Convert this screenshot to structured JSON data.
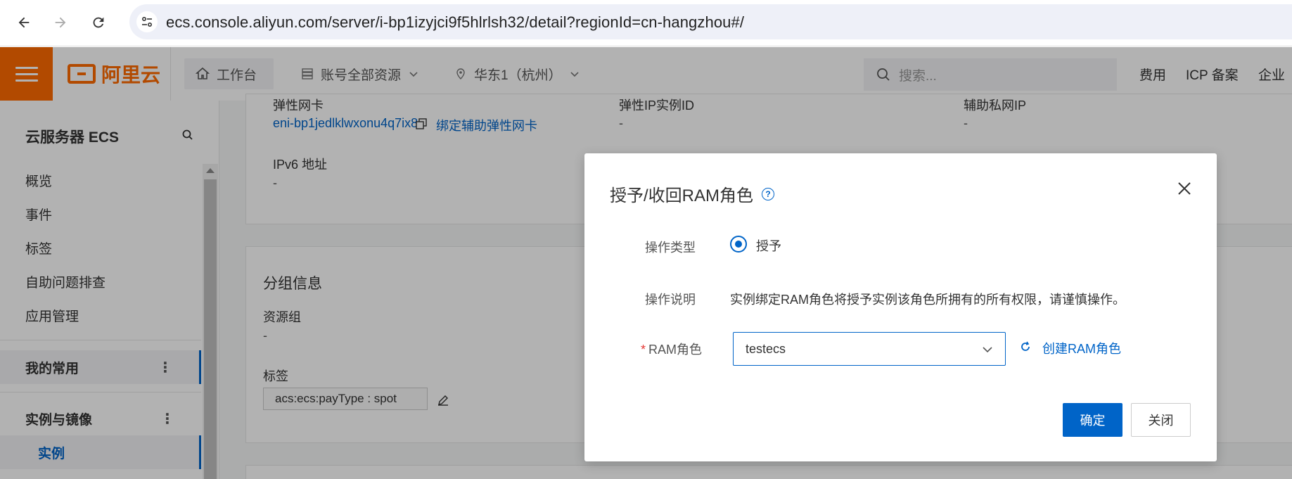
{
  "browser": {
    "url": "ecs.console.aliyun.com/server/i-bp1izyjci9f5hlrlsh32/detail?regionId=cn-hangzhou#/"
  },
  "header": {
    "brand": "阿里云",
    "workbench": "工作台",
    "resources": "账号全部资源",
    "region": "华东1（杭州）",
    "search_placeholder": "搜索...",
    "links": [
      "费用",
      "ICP 备案",
      "企业"
    ]
  },
  "sidebar": {
    "title": "云服务器 ECS",
    "items": [
      "概览",
      "事件",
      "标签",
      "自助问题排查",
      "应用管理"
    ],
    "sections": [
      {
        "label": "我的常用",
        "active": true
      },
      {
        "label": "实例与镜像",
        "active": false
      }
    ],
    "active_sub": "实例"
  },
  "main": {
    "network": {
      "eni_label": "弹性网卡",
      "eni_value": "eni-bp1jedlklwxonu4q7ix8",
      "bind_link": "绑定辅助弹性网卡",
      "eip_label": "弹性IP实例ID",
      "eip_value": "-",
      "private_ip_label": "辅助私网IP",
      "private_ip_value": "-",
      "ipv6_label": "IPv6 地址",
      "ipv6_value": "-"
    },
    "group": {
      "title": "分组信息",
      "resource_group_label": "资源组",
      "resource_group_value": "-",
      "tags_label": "标签",
      "tag_value": "acs:ecs:payType : spot"
    }
  },
  "dialog": {
    "title": "授予/收回RAM角色",
    "op_type_label": "操作类型",
    "op_type_value": "授予",
    "op_desc_label": "操作说明",
    "op_desc_value": "实例绑定RAM角色将授予实例该角色所拥有的所有权限，请谨慎操作。",
    "ram_role_required": "*",
    "ram_role_label": "RAM角色",
    "ram_role_value": "testecs",
    "create_link": "创建RAM角色",
    "confirm": "确定",
    "close": "关闭"
  },
  "colors": {
    "brand": "#ff6a00",
    "primary": "#0064c8",
    "required": "#e53935"
  }
}
